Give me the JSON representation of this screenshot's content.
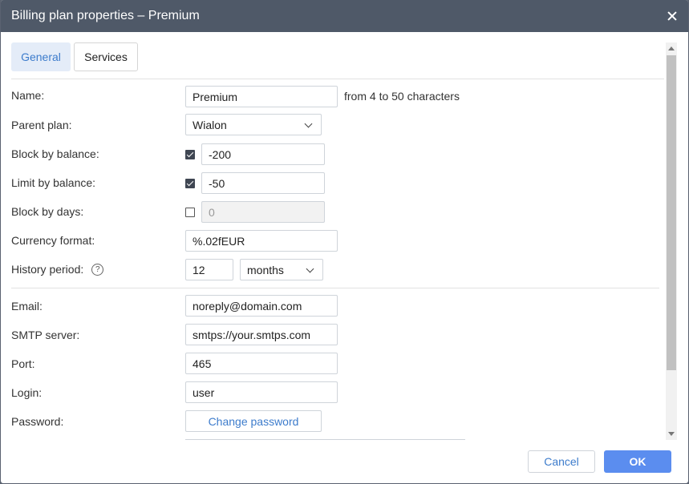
{
  "window": {
    "title": "Billing plan properties – Premium"
  },
  "tabs": [
    {
      "label": "General",
      "active": true
    },
    {
      "label": "Services",
      "active": false
    }
  ],
  "form": {
    "name": {
      "label": "Name:",
      "value": "Premium",
      "hint": "from 4 to 50 characters"
    },
    "parent_plan": {
      "label": "Parent plan:",
      "value": "Wialon"
    },
    "block_by_balance": {
      "label": "Block by balance:",
      "checked": true,
      "value": "-200"
    },
    "limit_by_balance": {
      "label": "Limit by balance:",
      "checked": true,
      "value": "-50"
    },
    "block_by_days": {
      "label": "Block by days:",
      "checked": false,
      "value": "0"
    },
    "currency_format": {
      "label": "Currency format:",
      "value": "%.02fEUR"
    },
    "history_period": {
      "label": "History period:",
      "value": "12",
      "unit": "months",
      "help_icon": "?"
    },
    "email": {
      "label": "Email:",
      "value": "noreply@domain.com"
    },
    "smtp_server": {
      "label": "SMTP server:",
      "value": "smtps://your.smtps.com"
    },
    "port": {
      "label": "Port:",
      "value": "465"
    },
    "login": {
      "label": "Login:",
      "value": "user"
    },
    "password": {
      "label": "Password:",
      "button": "Change password"
    }
  },
  "footer": {
    "cancel": "Cancel",
    "ok": "OK"
  },
  "colors": {
    "titlebar": "#4f5968",
    "accent": "#3d7ccc",
    "ok_button": "#5b8def"
  }
}
